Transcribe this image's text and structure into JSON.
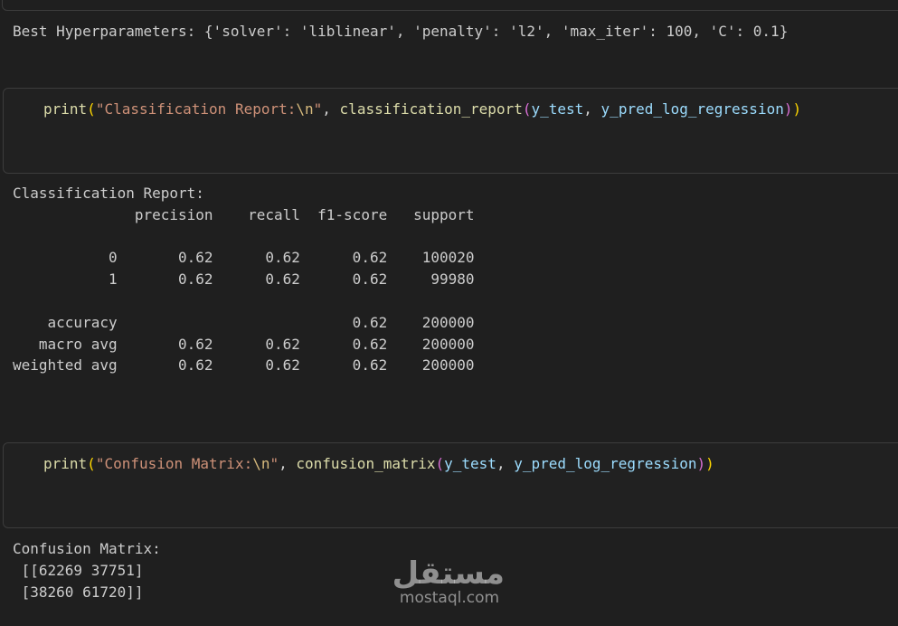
{
  "hyperparams_output": "Best Hyperparameters: {'solver': 'liblinear', 'penalty': 'l2', 'max_iter': 100, 'C': 0.1}",
  "cell_report": {
    "fn": "print",
    "open_paren": "(",
    "string": "\"Classification Report:",
    "escape": "\\n",
    "string_end": "\"",
    "comma": ", ",
    "inner_fn": "classification_report",
    "inner_open": "(",
    "arg1": "y_test",
    "sep": ", ",
    "arg2": "y_pred_log_regression",
    "inner_close": ")",
    "close_paren": ")"
  },
  "report_output": [
    "Classification Report:",
    "              precision    recall  f1-score   support",
    "",
    "           0       0.62      0.62      0.62    100020",
    "           1       0.62      0.62      0.62     99980",
    "",
    "    accuracy                           0.62    200000",
    "   macro avg       0.62      0.62      0.62    200000",
    "weighted avg       0.62      0.62      0.62    200000"
  ],
  "cell_confusion": {
    "fn": "print",
    "open_paren": "(",
    "string": "\"Confusion Matrix:",
    "escape": "\\n",
    "string_end": "\"",
    "comma": ", ",
    "inner_fn": "confusion_matrix",
    "inner_open": "(",
    "arg1": "y_test",
    "sep": ", ",
    "arg2": "y_pred_log_regression",
    "inner_close": ")",
    "close_paren": ")"
  },
  "confusion_output": [
    "Confusion Matrix:",
    " [[62269 37751]",
    " [38260 61720]]"
  ],
  "watermark": {
    "arabic": "مستقل",
    "latin": "mostaql.com"
  }
}
